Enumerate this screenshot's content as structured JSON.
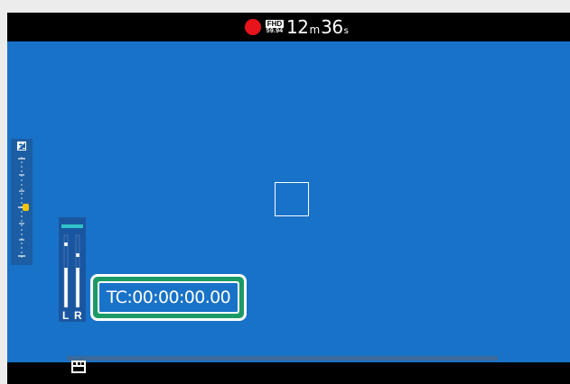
{
  "recording": {
    "status_icon": "record-icon",
    "status_color": "#e8141c",
    "format_top": "FHD",
    "format_bottom": "59.94",
    "minutes": "12",
    "minutes_unit": "m",
    "seconds": "36",
    "seconds_unit": "s"
  },
  "viewport": {
    "background_color": "#1872c8",
    "focus_frame_icon": "focus-frame-icon"
  },
  "exposure": {
    "icon": "exposure-compensation-icon",
    "indicator_color": "#f5c400"
  },
  "audio": {
    "left_label": "L",
    "right_label": "R",
    "peak_color": "#2ec4c8"
  },
  "timecode": {
    "text": "TC:00:00:00.00",
    "highlight_color": "#1c9a66"
  },
  "bottom": {
    "mode_icon": "movie-mode-icon"
  }
}
